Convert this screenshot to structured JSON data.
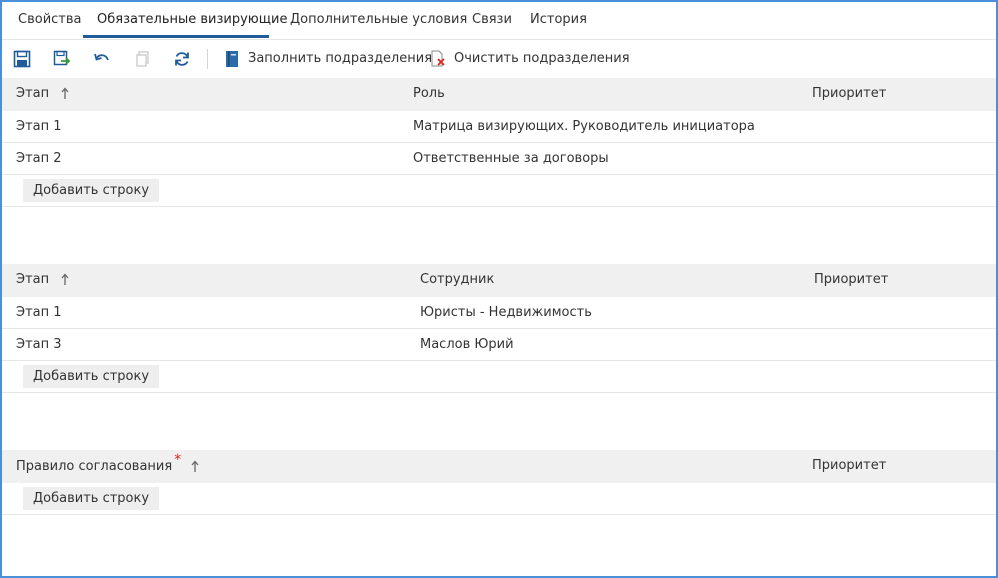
{
  "tabs": [
    {
      "label": "Свойства"
    },
    {
      "label": "Обязательные визирующие"
    },
    {
      "label": "Дополнительные условия"
    },
    {
      "label": "Связи"
    },
    {
      "label": "История"
    }
  ],
  "toolbar": {
    "fill_label": "Заполнить подразделения",
    "clear_label": "Очистить подразделения"
  },
  "roles_table": {
    "headers": {
      "stage": "Этап",
      "role": "Роль",
      "priority": "Приоритет"
    },
    "rows": [
      {
        "stage": "Этап 1",
        "role": "Матрица визирующих. Руководитель инициатора",
        "priority": ""
      },
      {
        "stage": "Этап 2",
        "role": "Ответственные за договоры",
        "priority": ""
      }
    ],
    "add_label": "Добавить строку"
  },
  "employees_table": {
    "headers": {
      "stage": "Этап",
      "employee": "Сотрудник",
      "priority": "Приоритет"
    },
    "rows": [
      {
        "stage": "Этап 1",
        "employee": "Юристы - Недвижимость",
        "priority": ""
      },
      {
        "stage": "Этап 3",
        "employee": "Маслов Юрий",
        "priority": ""
      }
    ],
    "add_label": "Добавить строку"
  },
  "rules_table": {
    "headers": {
      "rule": "Правило согласования",
      "required_mark": "*",
      "priority": "Приоритет"
    },
    "add_label": "Добавить строку"
  },
  "colors": {
    "accent": "#1f5c99",
    "frame": "#4a90d9",
    "required": "#d9241c",
    "header_bg": "#f0f0f0"
  }
}
